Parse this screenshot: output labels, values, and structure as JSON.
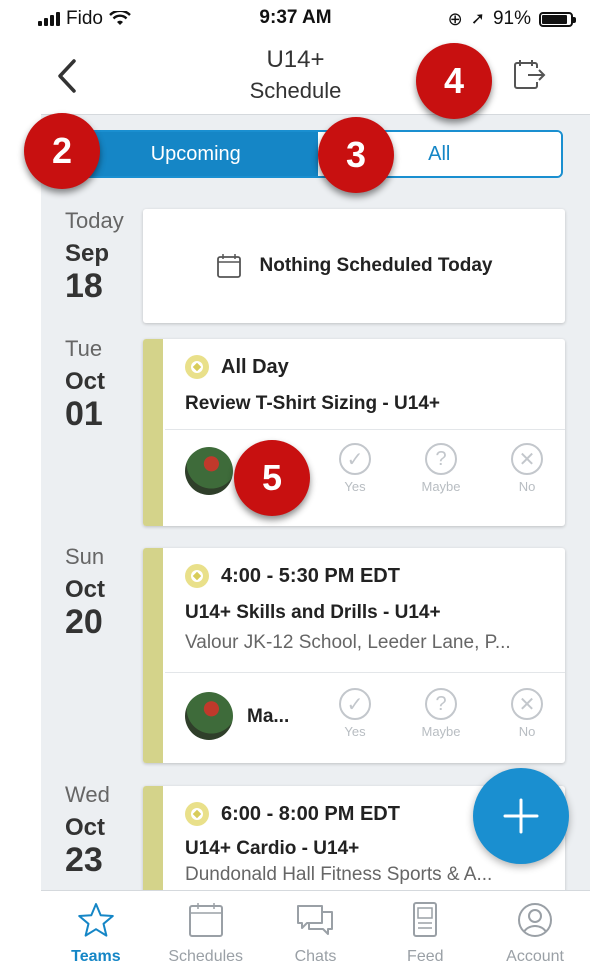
{
  "status": {
    "carrier": "Fido",
    "time": "9:37 AM",
    "battery": "91%"
  },
  "header": {
    "title": "U14+",
    "subtitle": "Schedule"
  },
  "segment": {
    "upcoming": "Upcoming",
    "all": "All"
  },
  "badges": {
    "b2": "2",
    "b3": "3",
    "b4": "4",
    "b5": "5"
  },
  "today": {
    "dow": "Today",
    "mon": "Sep",
    "day": "18",
    "empty_text": "Nothing Scheduled Today"
  },
  "events": [
    {
      "dow": "Tue",
      "mon": "Oct",
      "day": "01",
      "time": "All Day",
      "title": "Review T-Shirt Sizing - U14+",
      "location": "",
      "member": ""
    },
    {
      "dow": "Sun",
      "mon": "Oct",
      "day": "20",
      "time": "4:00 - 5:30 PM EDT",
      "title": "U14+ Skills and Drills - U14+",
      "location": "Valour JK-12 School, Leeder Lane, P...",
      "member": "Ma..."
    },
    {
      "dow": "Wed",
      "mon": "Oct",
      "day": "23",
      "time": "6:00 - 8:00 PM EDT",
      "title": "U14+ Cardio - U14+",
      "location": "Dundonald Hall Fitness Sports & A...",
      "member": ""
    }
  ],
  "rsvp": {
    "yes": "Yes",
    "maybe": "Maybe",
    "no": "No"
  },
  "tabs": [
    {
      "label": "Teams",
      "icon": "star-icon"
    },
    {
      "label": "Schedules",
      "icon": "calendar-icon"
    },
    {
      "label": "Chats",
      "icon": "chat-icon"
    },
    {
      "label": "Feed",
      "icon": "feed-icon"
    },
    {
      "label": "Account",
      "icon": "account-icon"
    }
  ],
  "colors": {
    "accent": "#1586c6",
    "badge": "#c81010",
    "stripe": "#d4d38a"
  }
}
